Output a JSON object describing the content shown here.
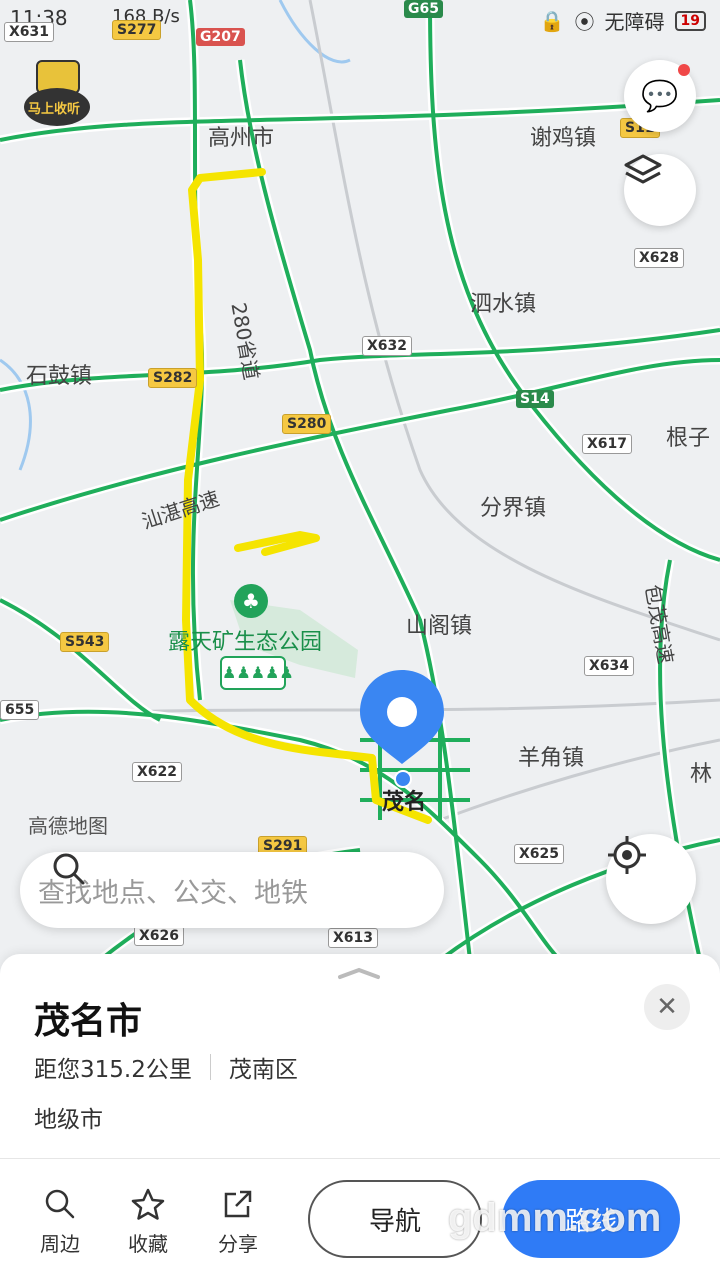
{
  "status_bar": {
    "time": "11:38",
    "speed": "168 B/s",
    "accessibility": "无障碍",
    "battery": "19"
  },
  "map": {
    "places": [
      "高州市",
      "谢鸡镇",
      "泗水镇",
      "石鼓镇",
      "分界镇",
      "根子",
      "山阁镇",
      "羊角镇",
      "茂名",
      "露天矿生态公园",
      "高德地图",
      "林"
    ],
    "road_labels": {
      "s280_side": "280省道",
      "expressway_shanzhan": "汕湛高速",
      "expressway_baomao": "包茂高速"
    },
    "badges": {
      "x631": "X631",
      "s277": "S277",
      "g207": "G207",
      "g65": "G65",
      "s11x": "S11",
      "x628": "X628",
      "x632": "X632",
      "s282": "S282",
      "s280": "S280",
      "s14": "S14",
      "x617": "X617",
      "s543": "S543",
      "x634": "X634",
      "x655": "655",
      "x622": "X622",
      "x625": "X625",
      "s291": "S291",
      "x613": "X613",
      "x626": "X626"
    },
    "corner_logo_text": "马上收听",
    "colors": {
      "road": "#1fae5b",
      "route": "#f5e400",
      "pin": "#3a86f2"
    }
  },
  "search": {
    "placeholder": "查找地点、公交、地铁",
    "icon": "search-icon"
  },
  "sheet": {
    "title": "茂名市",
    "distance": "距您315.2公里",
    "district": "茂南区",
    "type": "地级市",
    "actions": [
      {
        "label": "周边",
        "icon": "search-icon"
      },
      {
        "label": "收藏",
        "icon": "star-icon"
      },
      {
        "label": "分享",
        "icon": "share-icon"
      }
    ],
    "nav_button": "导航",
    "route_button": "路线"
  },
  "watermark": "gdmm.com"
}
